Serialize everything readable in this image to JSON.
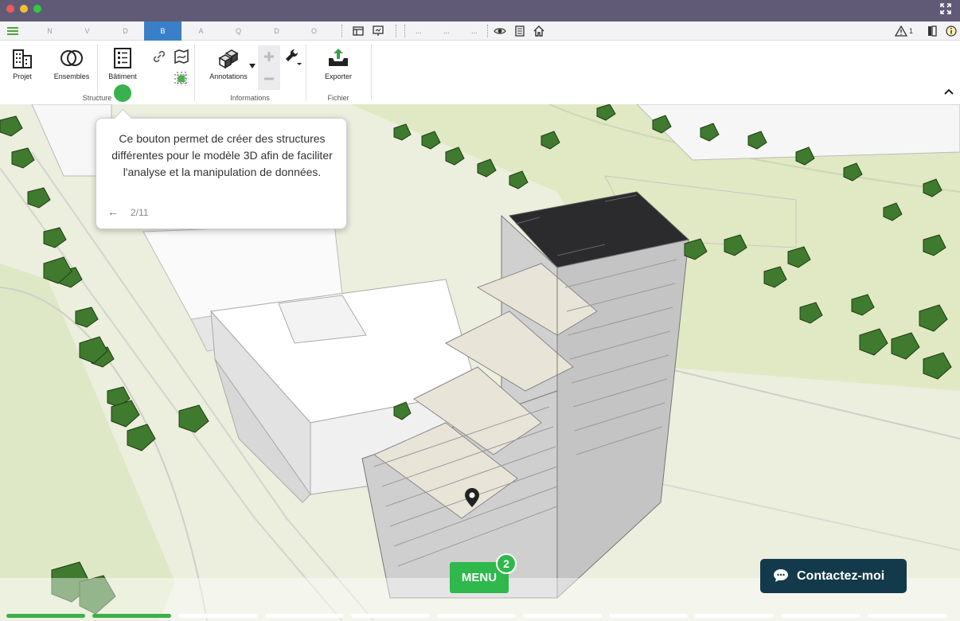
{
  "window": {
    "controls": [
      "close",
      "minimize",
      "zoom"
    ],
    "fullscreen_icon": "expand-icon"
  },
  "tabbar": {
    "tabs": [
      {
        "label": "N",
        "active": false
      },
      {
        "label": "V",
        "active": false
      },
      {
        "label": "D",
        "active": false
      },
      {
        "label": "B",
        "active": true
      },
      {
        "label": "A",
        "active": false
      },
      {
        "label": "Q",
        "active": false
      },
      {
        "label": "D",
        "active": false
      },
      {
        "label": "O",
        "active": false
      }
    ],
    "dots": [
      "...",
      "...",
      "..."
    ],
    "warning_count": "1"
  },
  "ribbon": {
    "groups": [
      {
        "label": "Structure"
      },
      {
        "label": "Informations"
      },
      {
        "label": "Fichier"
      }
    ],
    "buttons": {
      "projet": "Projet",
      "ensembles": "Ensembles",
      "batiment": "Bâtiment",
      "annotations": "Annotations",
      "exporter": "Exporter"
    }
  },
  "tooltip": {
    "text": "Ce bouton permet de créer des structures différentes pour le modèle 3D afin de faciliter l'analyse et la manipulation de données.",
    "back": "←",
    "step": "2/11"
  },
  "menu": {
    "label": "MENU",
    "badge": "2"
  },
  "contact": {
    "label": "Contactez-moi"
  },
  "tour_progress": {
    "total_steps": 11,
    "completed_steps": 2
  },
  "colors": {
    "titlebar": "#615a77",
    "active_tab": "#3a80c9",
    "accent_green": "#37b24d",
    "contact_bg": "#133a4a"
  }
}
